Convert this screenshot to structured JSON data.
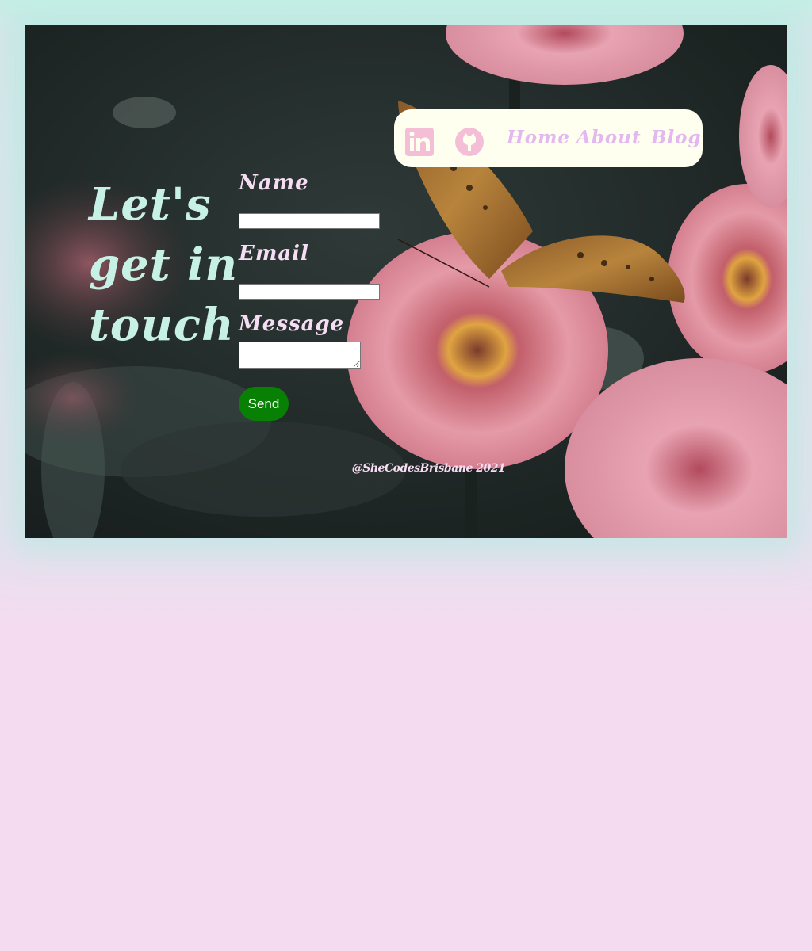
{
  "colors": {
    "page_background": "#f5dbf0",
    "headline": "#c8f1e6",
    "label": "#f7ddf3",
    "nav_background": "#fffff0",
    "nav_link": "#e3b8f0",
    "nav_icon": "#f4bfd6",
    "send_button": "#078004"
  },
  "hero": {
    "background_image": "pink-zinnia-flowers-with-butterfly-photo",
    "headline": "Let's get in touch"
  },
  "nav": {
    "icons": [
      "linkedin-icon",
      "github-icon"
    ],
    "links": [
      "Home",
      "About",
      "Blog"
    ]
  },
  "form": {
    "name_label": "Name",
    "name_value": "",
    "email_label": "Email",
    "email_value": "",
    "message_label": "Message",
    "message_value": "",
    "send_label": "Send"
  },
  "footer": {
    "text": "@SheCodesBrisbane 2021"
  }
}
